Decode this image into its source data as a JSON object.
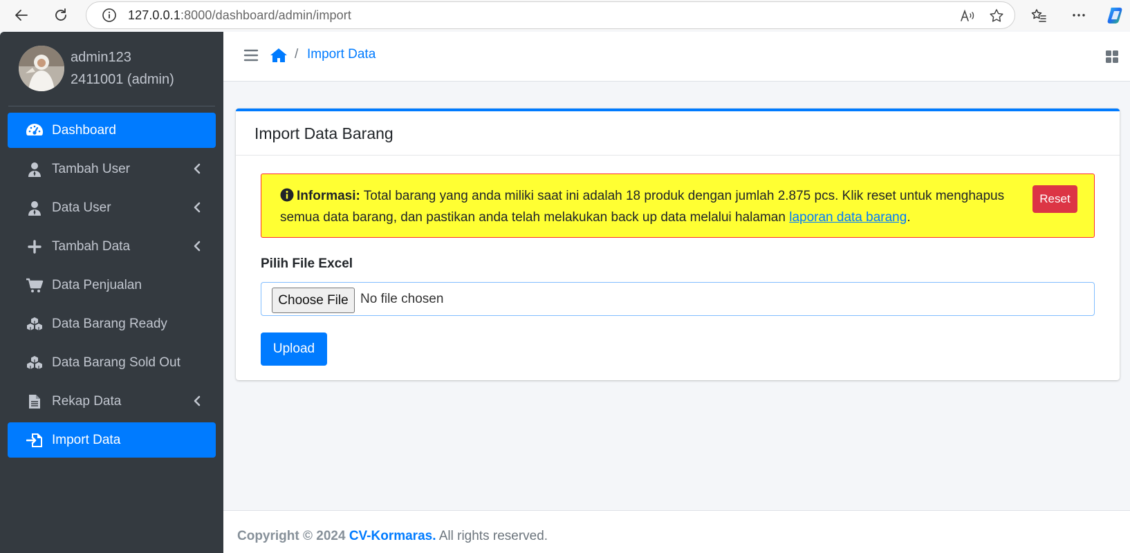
{
  "browser": {
    "url_host": "127.0.0.1",
    "url_path": ":8000/dashboard/admin/import"
  },
  "user": {
    "name": "admin123",
    "id_role": "2411001 (admin)"
  },
  "sidebar": {
    "items": [
      {
        "label": "Dashboard",
        "icon": "dashboard-gauge-icon",
        "active": true,
        "has_submenu": false
      },
      {
        "label": "Tambah User",
        "icon": "user-icon",
        "active": false,
        "has_submenu": true
      },
      {
        "label": "Data User",
        "icon": "user-icon",
        "active": false,
        "has_submenu": true
      },
      {
        "label": "Tambah Data",
        "icon": "plus-icon",
        "active": false,
        "has_submenu": true
      },
      {
        "label": "Data Penjualan",
        "icon": "cart-icon",
        "active": false,
        "has_submenu": false
      },
      {
        "label": "Data Barang Ready",
        "icon": "cubes-icon",
        "active": false,
        "has_submenu": false
      },
      {
        "label": "Data Barang Sold Out",
        "icon": "cubes-icon",
        "active": false,
        "has_submenu": false
      },
      {
        "label": "Rekap Data",
        "icon": "file-icon",
        "active": false,
        "has_submenu": true
      },
      {
        "label": "Import Data",
        "icon": "import-icon",
        "active": true,
        "has_submenu": false
      }
    ]
  },
  "navbar": {
    "breadcrumb_sep": "/",
    "breadcrumb_active": "Import Data"
  },
  "card": {
    "title": "Import Data Barang",
    "alert": {
      "label": "Informasi:",
      "text": " Total barang yang anda miliki saat ini adalah 18 produk dengan jumlah 2.875 pcs. Klik reset untuk menghapus semua data barang, dan pastikan anda telah melakukan back up data melalui halaman ",
      "link": "laporan data barang",
      "end": "."
    },
    "reset_label": "Reset",
    "file_label": "Pilih File Excel",
    "choose_label": "Choose File",
    "no_file": "No file chosen",
    "upload_label": "Upload"
  },
  "footer": {
    "copyright": "Copyright © 2024",
    "brand": "CV-Kormaras.",
    "rights": " All rights reserved."
  },
  "colors": {
    "primary": "#007bff",
    "danger": "#dc3545",
    "sidebar_bg": "#343a40",
    "alert_bg": "#ffff33"
  }
}
